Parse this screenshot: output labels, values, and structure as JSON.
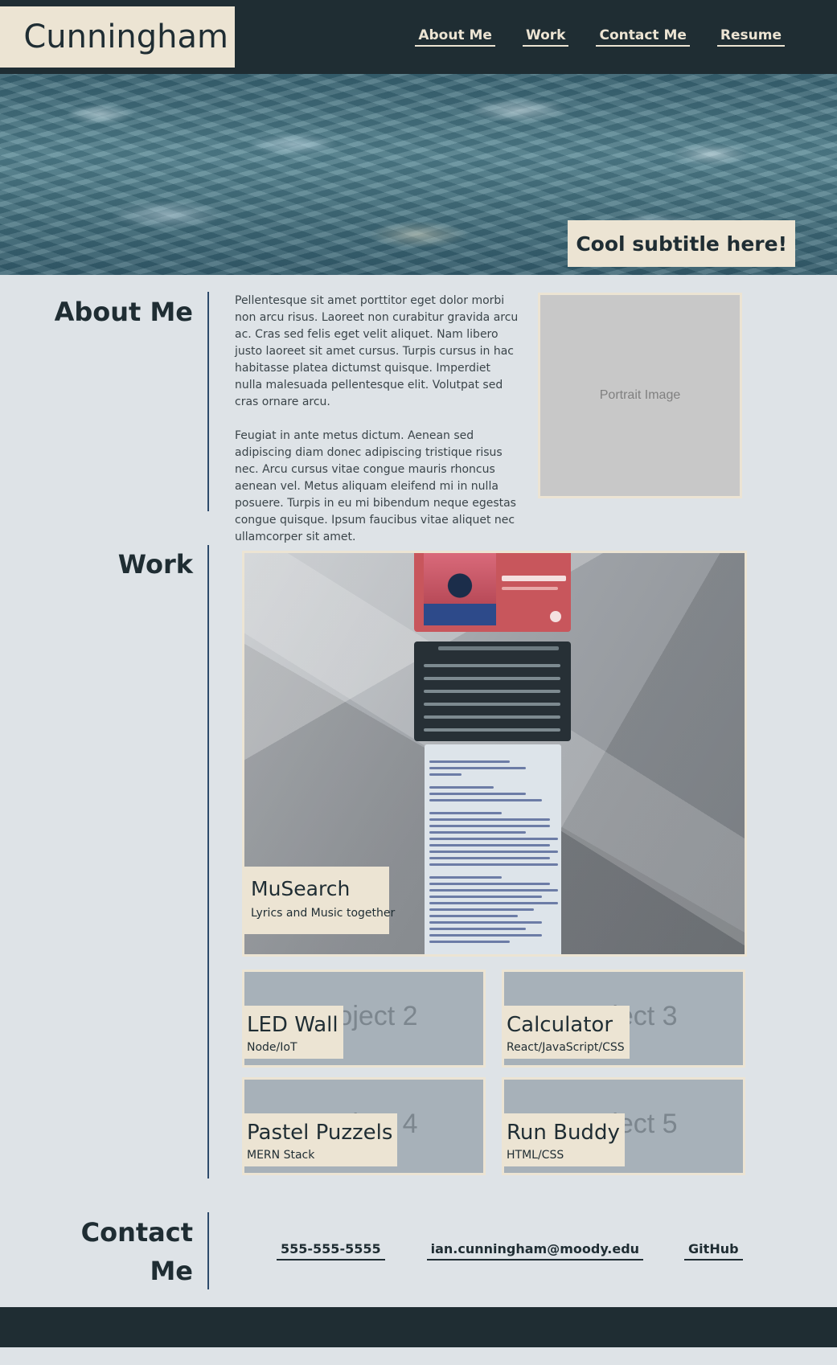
{
  "header": {
    "brand": "Cunningham",
    "nav": [
      "About Me",
      "Work",
      "Contact Me",
      "Resume"
    ]
  },
  "hero": {
    "subtitle": "Cool subtitle here!"
  },
  "about": {
    "title": "About Me",
    "paragraphs": [
      "Pellentesque sit amet porttitor eget dolor morbi non arcu risus. Laoreet non curabitur gravida arcu ac. Cras sed felis eget velit aliquet. Nam libero justo laoreet sit amet cursus. Turpis cursus in hac habitasse platea dictumst quisque. Imperdiet nulla malesuada pellentesque elit. Volutpat sed cras ornare arcu.",
      "Feugiat in ante metus dictum. Aenean sed adipiscing diam donec adipiscing tristique risus nec. Arcu cursus vitae congue mauris rhoncus aenean vel. Metus aliquam eleifend mi in nulla posuere. Turpis in eu mi bibendum neque egestas congue quisque. Ipsum faucibus vitae aliquet nec ullamcorper sit amet."
    ],
    "portrait_placeholder": "Portrait Image"
  },
  "work": {
    "title": "Work",
    "featured": {
      "name": "MuSearch",
      "stack": "Lyrics and Music together"
    },
    "projects": [
      {
        "placeholder": "Project 2",
        "name": "LED Wall",
        "stack": "Node/IoT"
      },
      {
        "placeholder": "Project 3",
        "name": "Calculator",
        "stack": "React/JavaScript/CSS"
      },
      {
        "placeholder": "Project 4",
        "name": "Pastel Puzzels",
        "stack": "MERN Stack"
      },
      {
        "placeholder": "Project 5",
        "name": "Run Buddy",
        "stack": "HTML/CSS"
      }
    ]
  },
  "contact": {
    "title_line1": "Contact",
    "title_line2": "Me",
    "links": [
      "555-555-5555",
      "ian.cunningham@moody.edu",
      "GitHub"
    ]
  },
  "colors": {
    "dark": "#1f2d33",
    "cream": "#ece4d3",
    "background": "#dee3e7",
    "accent_line": "#2d4a6b"
  }
}
